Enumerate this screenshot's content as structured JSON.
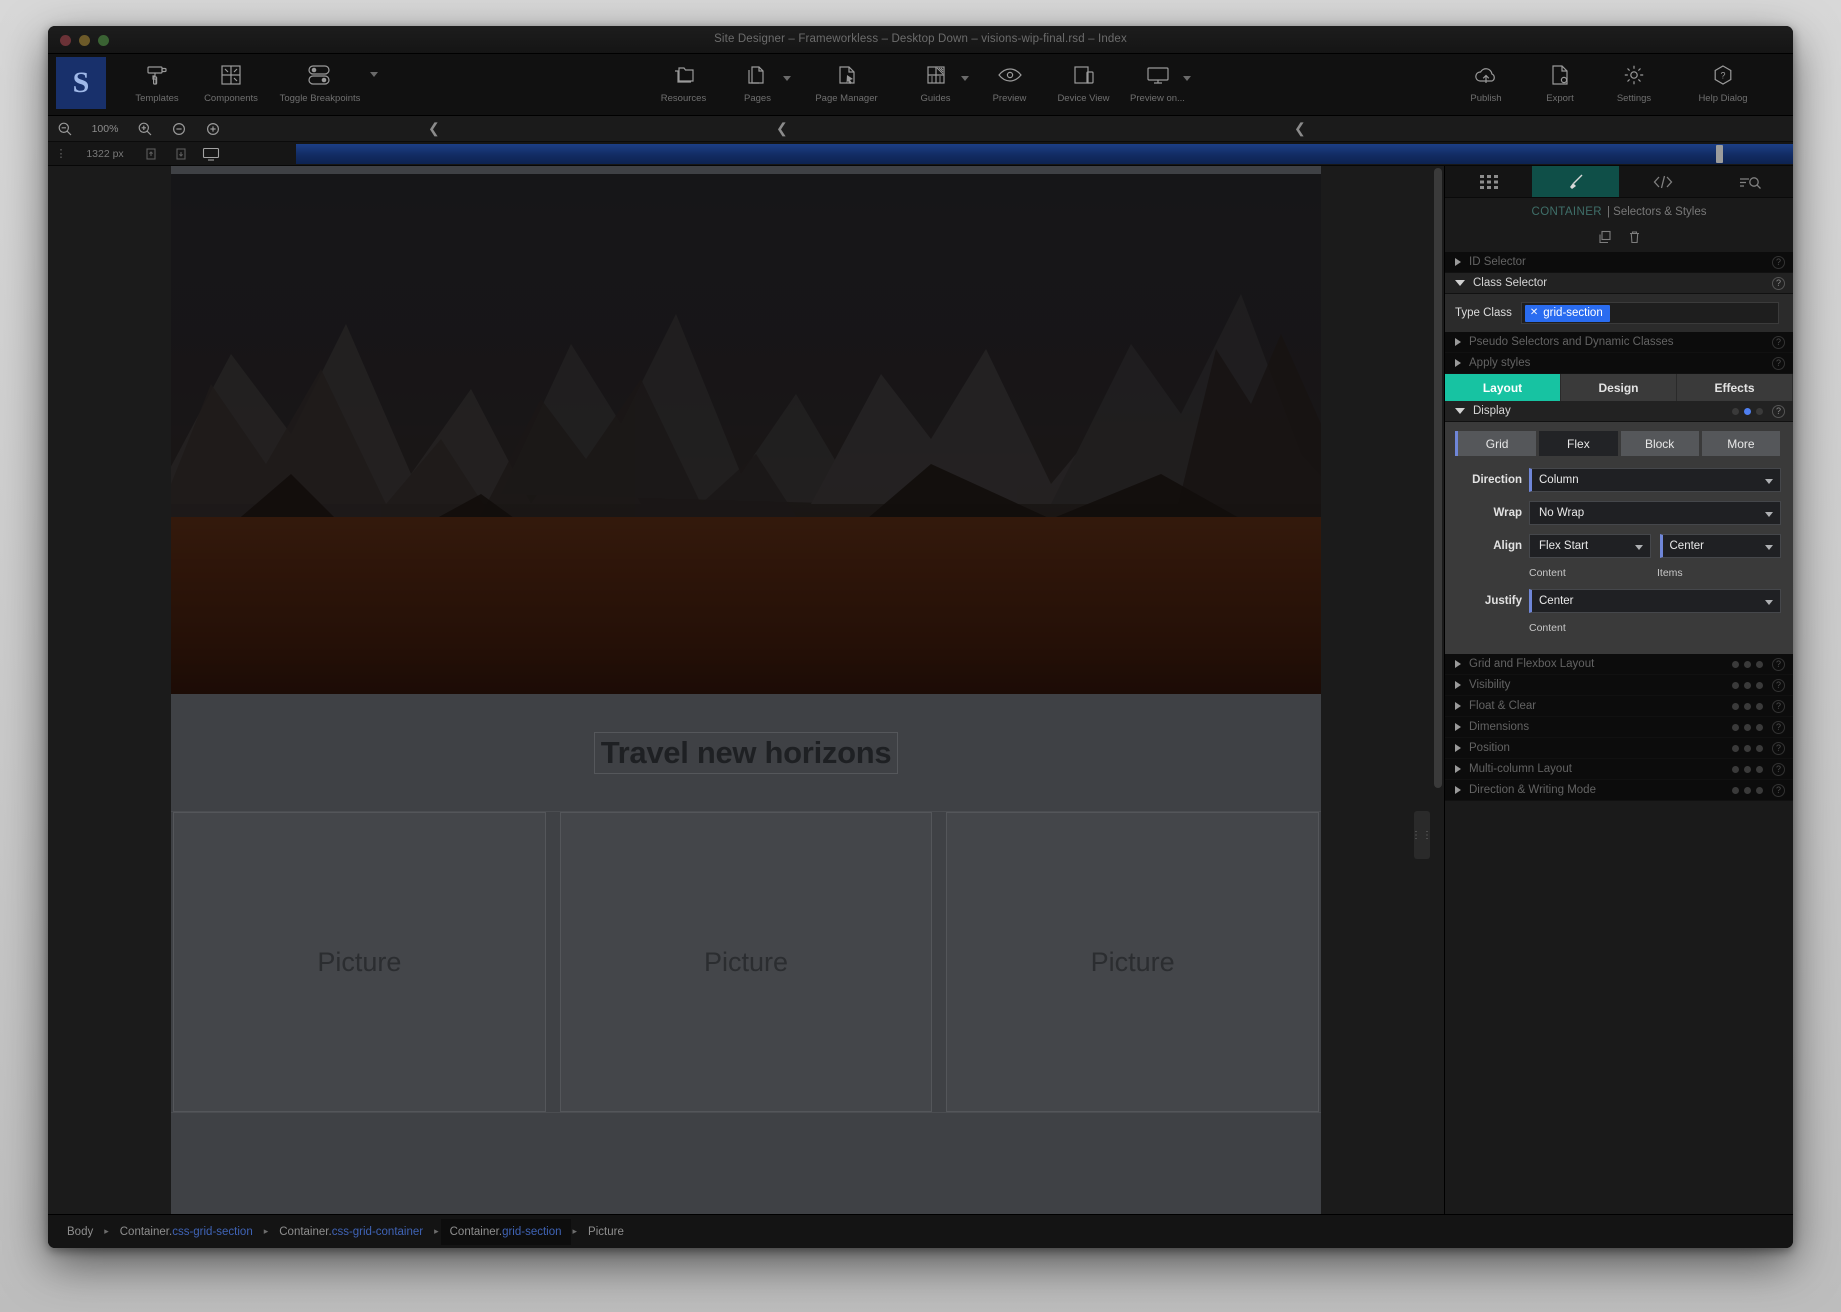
{
  "window": {
    "title": "Site Designer – Frameworkless – Desktop Down – visions-wip-final.rsd – Index"
  },
  "toolbar": {
    "logo": "S",
    "left": [
      {
        "label": "Templates",
        "icon": "paint-roller-icon"
      },
      {
        "label": "Components",
        "icon": "components-grid-icon"
      },
      {
        "label": "Toggle Breakpoints",
        "icon": "toggle-switches-icon"
      }
    ],
    "center": [
      {
        "label": "Resources",
        "icon": "folders-icon"
      },
      {
        "label": "Pages",
        "icon": "pages-copy-icon",
        "caret": true
      },
      {
        "label": "Page Manager",
        "icon": "page-cursor-icon"
      },
      {
        "label": "Guides",
        "icon": "guides-layout-icon",
        "caret": true
      },
      {
        "label": "Preview",
        "icon": "eye-icon"
      },
      {
        "label": "Device View",
        "icon": "device-view-icon"
      },
      {
        "label": "Preview on...",
        "icon": "monitor-icon",
        "caret": true
      }
    ],
    "right": [
      {
        "label": "Publish",
        "icon": "cloud-upload-icon"
      },
      {
        "label": "Export",
        "icon": "export-document-icon"
      },
      {
        "label": "Settings",
        "icon": "gear-icon"
      },
      {
        "label": "Help Dialog",
        "icon": "help-hexagon-icon"
      }
    ]
  },
  "zoomstrip": {
    "zoom_out_icon": "zoom-out-icon",
    "zoom_value": "100%",
    "zoom_in_icon": "zoom-in-icon",
    "minus_icon": "minus-circle-icon",
    "plus_icon": "plus-circle-icon",
    "ruler_arrows": [
      "❮",
      "❮",
      "❮"
    ]
  },
  "breakpoint_bar": {
    "grip": "⋮",
    "width_value": "1322 px",
    "icons": [
      "breakpoint-up-icon",
      "breakpoint-down-icon",
      "desktop-icon"
    ],
    "track_color": "#16357a",
    "marker": "breakpoint-marker"
  },
  "canvas": {
    "hero_image_alt": "dark desert mountain landscape",
    "headline": "Travel new horizons",
    "cards": [
      {
        "label": "Picture"
      },
      {
        "label": "Picture"
      },
      {
        "label": "Picture"
      }
    ]
  },
  "inspector": {
    "tabs": [
      {
        "name": "grid-panel-tab",
        "icon": "grid-dots-icon",
        "active": false
      },
      {
        "name": "styles-panel-tab",
        "icon": "paintbrush-icon",
        "active": true
      },
      {
        "name": "code-panel-tab",
        "icon": "code-brackets-icon",
        "active": false
      },
      {
        "name": "search-panel-tab",
        "icon": "list-search-icon",
        "active": false
      }
    ],
    "title_element": "CONTAINER",
    "title_rest": "| Selectors & Styles",
    "actions": [
      {
        "name": "duplicate-icon"
      },
      {
        "name": "delete-icon"
      }
    ],
    "selectors": [
      {
        "label": "ID Selector",
        "open": false,
        "dim": true
      },
      {
        "label": "Class Selector",
        "open": true,
        "dim": false
      }
    ],
    "type_class": {
      "label": "Type Class",
      "chip": "grid-section",
      "chip_remove": "✕",
      "chip_color": "#2a6cf0"
    },
    "sub_selectors": [
      {
        "label": "Pseudo Selectors and Dynamic Classes"
      },
      {
        "label": "Apply styles"
      }
    ],
    "style_tabs": [
      {
        "label": "Layout",
        "active": true
      },
      {
        "label": "Design",
        "active": false
      },
      {
        "label": "Effects",
        "active": false
      }
    ],
    "accent_color": "#17c3a2",
    "display": {
      "section_label": "Display",
      "dots": [
        false,
        true,
        false
      ],
      "modes": [
        {
          "label": "Grid",
          "selected": false
        },
        {
          "label": "Flex",
          "selected": true
        },
        {
          "label": "Block",
          "selected": false
        },
        {
          "label": "More",
          "selected": false
        }
      ],
      "fields": [
        {
          "label": "Direction",
          "value": "Column"
        },
        {
          "label": "Wrap",
          "value": "No Wrap"
        }
      ],
      "align": {
        "label": "Align",
        "content_value": "Flex Start",
        "content_sub": "Content",
        "items_value": "Center",
        "items_sub": "Items"
      },
      "justify": {
        "label": "Justify",
        "value": "Center",
        "sub": "Content"
      }
    },
    "collapsed_sections": [
      "Grid and Flexbox Layout",
      "Visibility",
      "Float & Clear",
      "Dimensions",
      "Position",
      "Multi-column Layout",
      "Direction & Writing Mode"
    ],
    "help_glyph": "?"
  },
  "breadcrumb": [
    {
      "name": "Body",
      "cls": "",
      "selected": false
    },
    {
      "name": "Container.",
      "cls": "css-grid-section",
      "selected": false
    },
    {
      "name": "Container.",
      "cls": "css-grid-container",
      "selected": false
    },
    {
      "name": "Container.",
      "cls": "grid-section",
      "selected": true
    },
    {
      "name": "Picture",
      "cls": "",
      "selected": false
    }
  ],
  "breadcrumb_sep": "▸"
}
